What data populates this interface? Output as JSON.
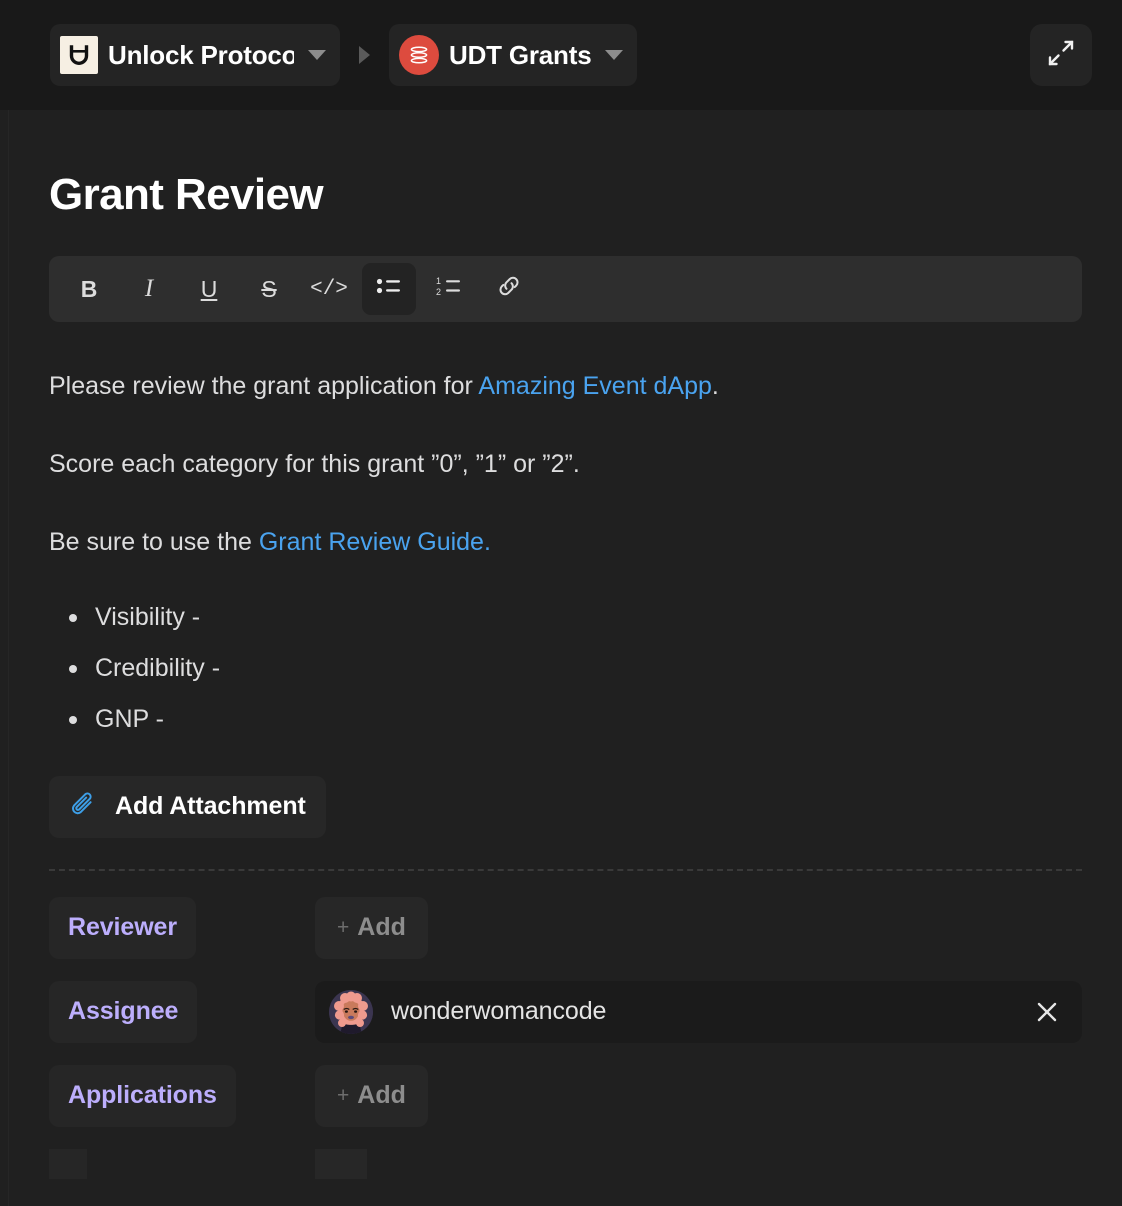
{
  "breadcrumb": {
    "items": [
      {
        "label": "Unlock Protocol",
        "icon": "unlock-protocol-logo",
        "caret": "chevron-down-icon"
      },
      {
        "label": "UDT Grants",
        "icon": "udt-grants-logo",
        "caret": "chevron-down-icon"
      }
    ],
    "separator_icon": "caret-right-icon",
    "expand_icon": "expand-diagonal-icon"
  },
  "page": {
    "title": "Grant Review"
  },
  "editor_toolbar": {
    "buttons": [
      {
        "name": "bold",
        "glyph": "B",
        "active": false
      },
      {
        "name": "italic",
        "glyph": "I",
        "active": false
      },
      {
        "name": "underline",
        "glyph": "U",
        "active": false
      },
      {
        "name": "strikethrough",
        "glyph": "S",
        "active": false
      },
      {
        "name": "code",
        "glyph": "</>",
        "active": false
      },
      {
        "name": "bulleted-list",
        "glyph": "bullet-list-icon",
        "active": true
      },
      {
        "name": "numbered-list",
        "glyph": "numbered-list-icon",
        "active": false
      },
      {
        "name": "link",
        "glyph": "link-icon",
        "active": false
      }
    ]
  },
  "content": {
    "paragraph_1": {
      "before": "Please review the grant application for ",
      "link": "Amazing Event dApp",
      "after": "."
    },
    "paragraph_2": "Score each category for this grant ”0”, ”1” or ”2”.",
    "paragraph_3": {
      "before": "Be sure to use the ",
      "link": "Grant Review Guide.",
      "after": ""
    },
    "bullets": [
      "Visibility -",
      "Credibility -",
      "GNP -"
    ],
    "attachment_button": {
      "label": "Add Attachment",
      "icon": "paperclip-icon"
    }
  },
  "properties": [
    {
      "key": "Reviewer",
      "value_type": "add",
      "add_label": "Add",
      "add_plus": "+"
    },
    {
      "key": "Assignee",
      "value_type": "user",
      "user": "wonderwomancode",
      "avatar_icon": "user-avatar",
      "remove_icon": "close-icon"
    },
    {
      "key": "Applications",
      "value_type": "add",
      "add_label": "Add",
      "add_plus": "+"
    },
    {
      "key": "",
      "value_type": "add",
      "add_label": "",
      "add_plus": ""
    }
  ],
  "colors": {
    "background": "#202020",
    "topbar": "#191919",
    "accent_link": "#4aa3ef",
    "property_key": "#bcaefc",
    "brand_red": "#dd4b3e",
    "brand_cream": "#f6efe3"
  }
}
